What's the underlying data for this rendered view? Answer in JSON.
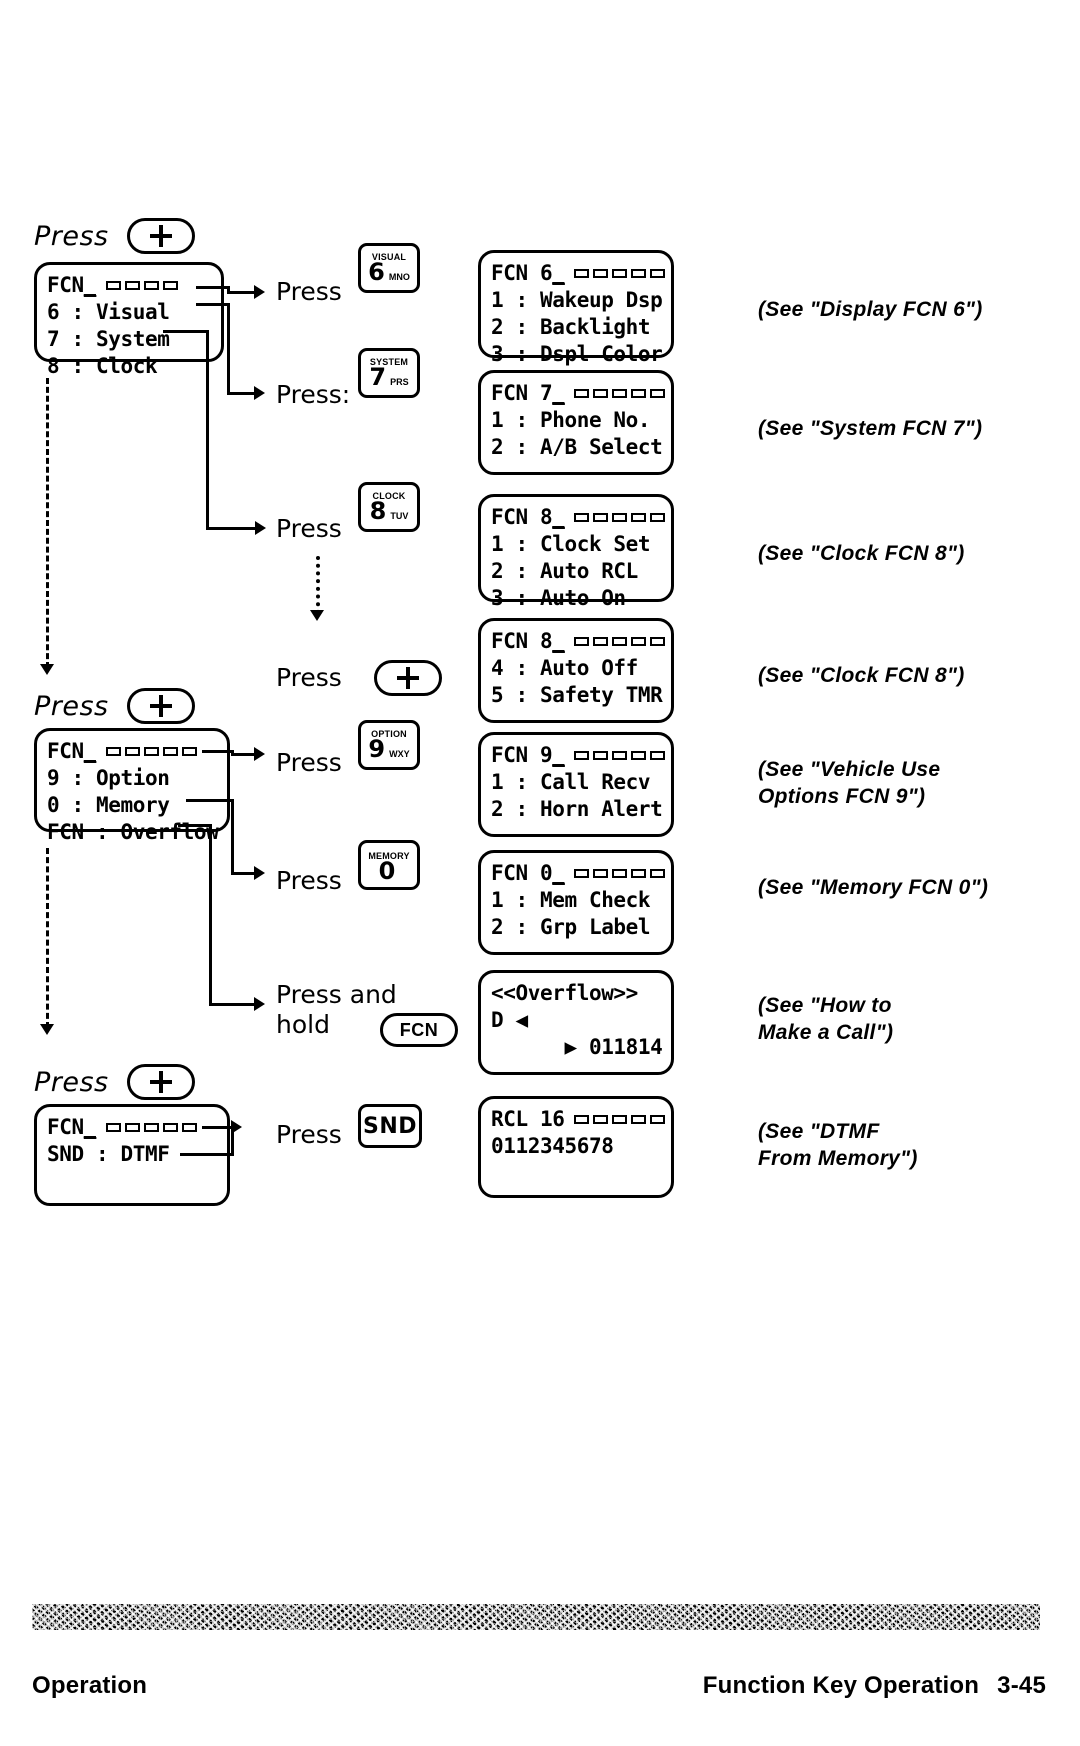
{
  "page": {
    "footer_left": "Operation",
    "footer_right": "Function Key Operation",
    "page_number": "3-45"
  },
  "groups": [
    {
      "id": "group-1",
      "heading": {
        "press_word": "Press",
        "key": "+"
      },
      "menu": {
        "title": "FCN",
        "cursor": "_",
        "signal_bars": 5,
        "items": [
          "6 : Visual",
          "7 : System",
          "8 : Clock"
        ]
      },
      "branches": [
        {
          "press_label": "Press",
          "key": {
            "function": "VISUAL",
            "digit": "6",
            "letters": "MNO"
          },
          "result": {
            "title": "FCN 6",
            "cursor": "_",
            "signal_bars": 5,
            "items": [
              "1 : Wakeup Dsp",
              "2 : Backlight",
              "3 : Dspl Color"
            ]
          },
          "note": "(See \"Display FCN 6\")"
        },
        {
          "press_label": "Press:",
          "key": {
            "function": "SYSTEM",
            "digit": "7",
            "letters": "PRS"
          },
          "result": {
            "title": "FCN 7",
            "cursor": "_",
            "signal_bars": 5,
            "items": [
              "1 : Phone No.",
              "2 : A/B Select"
            ]
          },
          "note": "(See \"System FCN 7\")"
        },
        {
          "press_label": "Press",
          "key": {
            "function": "CLOCK",
            "digit": "8",
            "letters": "TUV"
          },
          "result": {
            "title": "FCN 8",
            "cursor": "_",
            "signal_bars": 5,
            "items": [
              "1 : Clock Set",
              "2 : Auto RCL",
              "3 : Auto On"
            ]
          },
          "note": "(See \"Clock FCN 8\")"
        },
        {
          "press_label": "Press",
          "key": {
            "function": "",
            "digit": "+",
            "letters": ""
          },
          "result": {
            "title": "FCN 8",
            "cursor": "_",
            "signal_bars": 5,
            "items": [
              "4 : Auto Off",
              "5 : Safety TMR"
            ]
          },
          "note": "(See \"Clock FCN 8\")"
        }
      ]
    },
    {
      "id": "group-2",
      "heading": {
        "press_word": "Press",
        "key": "+"
      },
      "menu": {
        "title": "FCN",
        "cursor": "_",
        "signal_bars": 5,
        "items": [
          "9 : Option",
          "0 : Memory",
          "FCN : Overflow"
        ]
      },
      "branches": [
        {
          "press_label": "Press",
          "key": {
            "function": "OPTION",
            "digit": "9",
            "letters": "WXY"
          },
          "result": {
            "title": "FCN 9",
            "cursor": "_",
            "signal_bars": 5,
            "items": [
              "1 : Call Recv",
              "2 : Horn Alert"
            ]
          },
          "note": "(See \"Vehicle Use\nOptions FCN 9\")"
        },
        {
          "press_label": "Press",
          "key": {
            "function": "MEMORY",
            "digit": "0",
            "letters": ""
          },
          "result": {
            "title": "FCN 0",
            "cursor": "_",
            "signal_bars": 5,
            "items": [
              "1 : Mem Check",
              "2 : Grp Label"
            ]
          },
          "note": "(See \"Memory FCN 0\")"
        },
        {
          "press_label": "Press and\nhold",
          "key": {
            "function": "",
            "digit": "FCN",
            "letters": ""
          },
          "result": {
            "title": "<<Overflow>>",
            "cursor": "",
            "signal_bars": 0,
            "items": [
              "D ◀",
              "",
              "      ▶ 011814"
            ]
          },
          "note": "(See \"How to\nMake a Call\")"
        }
      ]
    },
    {
      "id": "group-3",
      "heading": {
        "press_word": "Press",
        "key": "+"
      },
      "menu": {
        "title": "FCN",
        "cursor": "_",
        "signal_bars": 5,
        "items": [
          "SND : DTMF"
        ]
      },
      "branches": [
        {
          "press_label": "Press",
          "key": {
            "function": "",
            "digit": "SND",
            "letters": ""
          },
          "result": {
            "title": "RCL 16",
            "cursor": "",
            "signal_bars": 5,
            "items": [
              "",
              "0112345678"
            ]
          },
          "note": "(See \"DTMF\nFrom Memory\")"
        }
      ]
    }
  ]
}
